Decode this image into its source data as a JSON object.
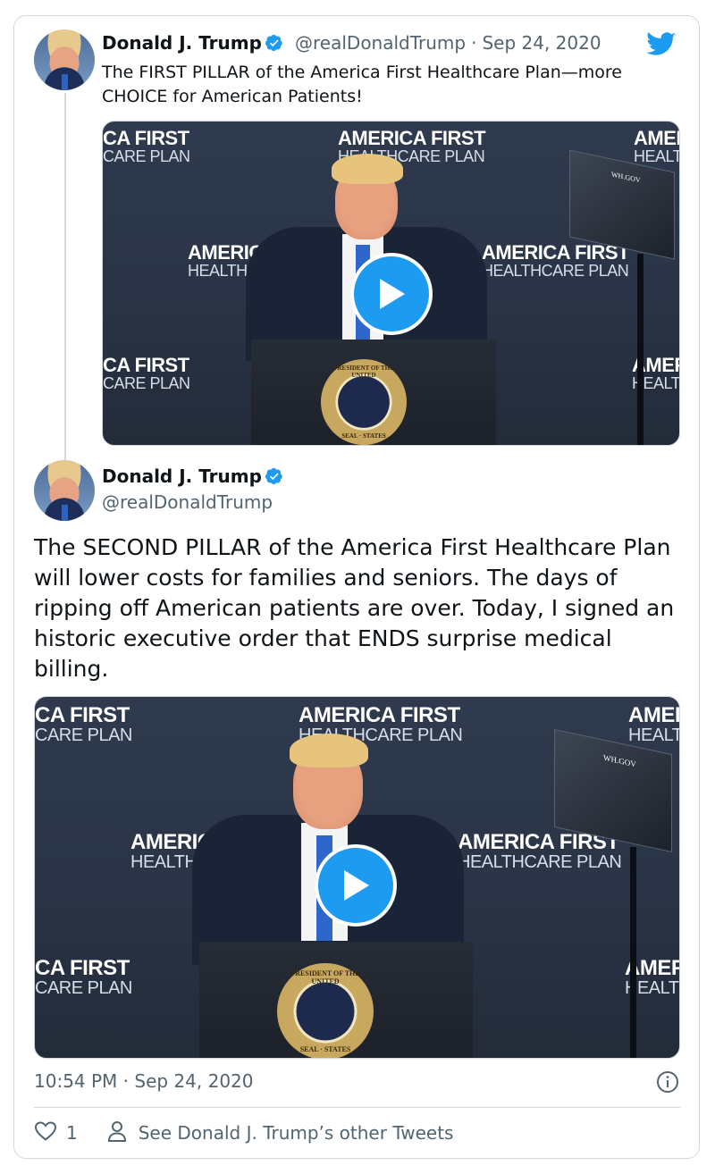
{
  "tweet1": {
    "name": "Donald J. Trump",
    "handle": "@realDonaldTrump",
    "separator": "·",
    "date": "Sep 24, 2020",
    "text": "The FIRST PILLAR of the America First Healthcare Plan—more CHOICE for American Patients!"
  },
  "tweet2": {
    "name": "Donald J. Trump",
    "handle": "@realDonaldTrump",
    "text": "The SECOND PILLAR of the America First Healthcare Plan will lower costs for families and seniors. The days of ripping off American patients are over. Today, I signed an historic executive order that ENDS surprise medical billing.",
    "timestamp": "10:54 PM · Sep 24, 2020"
  },
  "video_backdrop": {
    "left_top_1": "CA FIRST",
    "left_top_2": "CARE PLAN",
    "center_top_1": "AMERICA FIRST",
    "center_top_2": "HEALTHCARE PLAN",
    "right_top_1": "AMEI",
    "right_top_2": "HEALT",
    "mid_left_1": "AMERICA",
    "mid_left_2": "HEALTHCA",
    "mid_right_1": "AMERICA FIRST",
    "mid_right_2": "HEALTHCARE PLAN",
    "low_left_1": "CA FIRST",
    "low_left_2": "CARE PLAN",
    "low_right_1": "AMEF",
    "low_right_2": "HEALT",
    "wh_gov": "WH.GOV",
    "seal_top": "PRESIDENT OF THE UNITED",
    "seal_bottom": "SEAL · STATES"
  },
  "actions": {
    "like_count": "1",
    "other_tweets_label": "See Donald J. Trump’s other Tweets"
  },
  "colors": {
    "accent": "#1d9bf0",
    "text": "#0f1419",
    "muted": "#536471",
    "border": "#cfd9de"
  },
  "icons": [
    "twitter-bird-icon",
    "verified-badge-icon",
    "play-icon",
    "info-icon",
    "heart-icon",
    "person-icon"
  ]
}
